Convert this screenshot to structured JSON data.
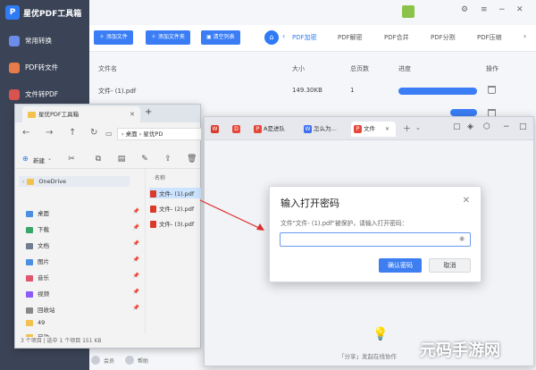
{
  "app": {
    "title": "星优PDF工具箱",
    "sidebar": [
      {
        "label": "常用转换",
        "active": false
      },
      {
        "label": "PDF转文件",
        "active": false
      },
      {
        "label": "文件转PDF",
        "active": false
      }
    ],
    "toolbar_buttons": [
      "添加文件",
      "添加文件夹",
      "清空列表"
    ],
    "tabs": [
      "PDF加密",
      "PDF解密",
      "PDF合并",
      "PDF分割",
      "PDF压缩"
    ],
    "active_tab": "PDF加密",
    "table_headers": [
      "文件名",
      "大小",
      "总页数",
      "进度",
      "操作"
    ],
    "row": {
      "name": "文件- (1).pdf",
      "size": "149.30KB",
      "pages": "1",
      "progress": 1.0
    },
    "footer": [
      "会员",
      "帮助"
    ]
  },
  "explorer": {
    "tab_title": "星优PDF工具箱",
    "add_tab": "+",
    "address": [
      "桌面",
      "星优PD"
    ],
    "new_label": "新建",
    "column_header": "名称",
    "tree": [
      {
        "label": "OneDrive",
        "color": "#f2c14e"
      },
      {
        "label": "桌面",
        "color": "#4a8fe0"
      },
      {
        "label": "下载",
        "color": "#3aa56a"
      },
      {
        "label": "文档",
        "color": "#6f7d8c"
      },
      {
        "label": "图片",
        "color": "#4a8fe0"
      },
      {
        "label": "音乐",
        "color": "#e0566b"
      },
      {
        "label": "视频",
        "color": "#8b5cf6"
      },
      {
        "label": "回收站",
        "color": "#888888"
      },
      {
        "label": "49",
        "color": "#f2c14e"
      },
      {
        "label": "已功",
        "color": "#f2c14e"
      }
    ],
    "files": [
      "文件- (1).pdf",
      "文件- (2).pdf",
      "文件- (3).pdf"
    ],
    "status": "3 个项目  |  选中 1 个项目  151 KB"
  },
  "viewer": {
    "tabs": [
      {
        "label": "",
        "icon_color": "#d93b2b",
        "icon": "W"
      },
      {
        "label": "",
        "icon_color": "#e5483a",
        "icon": "D"
      },
      {
        "label": "A是进队",
        "icon_color": "#e5483a",
        "icon": "P"
      },
      {
        "label": "怎么为…",
        "icon_color": "#3d6ef0",
        "icon": "W"
      },
      {
        "label": "文件",
        "icon_color": "#e5483a",
        "icon": "P"
      }
    ],
    "hint": "「分享」发起在线协作"
  },
  "dialog": {
    "title": "输入打开密码",
    "message": "文件\"文件- (1).pdf\"被保护，请输入打开密码：",
    "password_value": "",
    "ok_label": "确认密码",
    "cancel_label": "取消"
  },
  "watermark": "元码手游网"
}
